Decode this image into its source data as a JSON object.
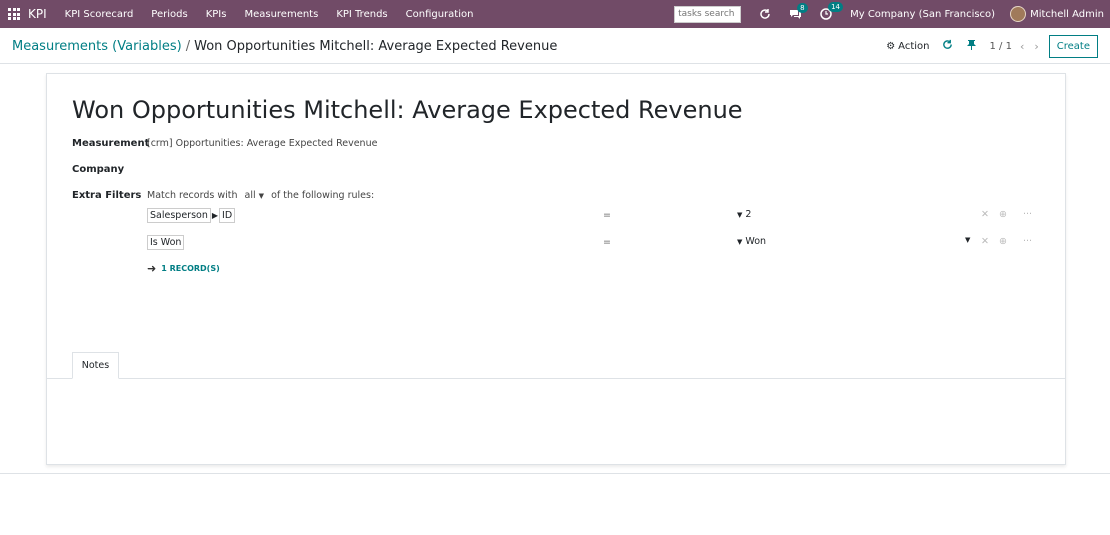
{
  "navbar": {
    "app_name": "KPI",
    "menu": [
      "KPI Scorecard",
      "Periods",
      "KPIs",
      "Measurements",
      "KPI Trends",
      "Configuration"
    ],
    "search_placeholder": "tasks search",
    "messages_count": "8",
    "activities_count": "14",
    "company": "My Company (San Francisco)",
    "user": "Mitchell Admin",
    "color": "#714B67"
  },
  "breadcrumb": {
    "parent": "Measurements (Variables)",
    "separator": "/",
    "current": "Won Opportunities Mitchell: Average Expected Revenue"
  },
  "control": {
    "action_label": "Action",
    "pager": "1 / 1",
    "create_label": "Create"
  },
  "form": {
    "title": "Won Opportunities Mitchell: Average Expected Revenue",
    "measurement_label": "Measurement",
    "measurement_value": "[crm] Opportunities: Average Expected Revenue",
    "company_label": "Company",
    "company_value": "",
    "extra_filters_label": "Extra Filters",
    "match_prefix": "Match records with",
    "match_selector": "all",
    "match_suffix": "of the following rules:",
    "rules": [
      {
        "field": "Salesperson",
        "subfield": "ID",
        "operator": "=",
        "value": "2"
      },
      {
        "field": "Is Won",
        "operator": "=",
        "value": "Won"
      }
    ],
    "records_link": "1 RECORD(S)"
  },
  "tabs": [
    "Notes"
  ],
  "accent_color": "#017e84"
}
